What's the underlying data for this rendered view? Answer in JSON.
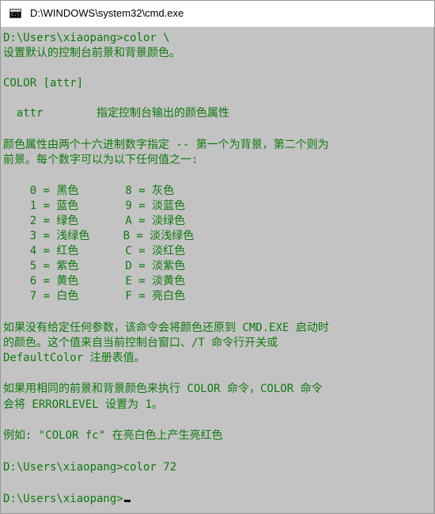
{
  "window": {
    "title": "D:\\WINDOWS\\system32\\cmd.exe",
    "icon_text": "C:\\"
  },
  "console": {
    "lines": [
      "D:\\Users\\xiaopang>color \\",
      "设置默认的控制台前景和背景颜色。",
      "",
      "COLOR [attr]",
      "",
      "  attr        指定控制台输出的颜色属性",
      "",
      "颜色属性由两个十六进制数字指定 -- 第一个为背景，第二个则为",
      "前景。每个数字可以为以下任何值之一:",
      "",
      "    0 = 黑色       8 = 灰色",
      "    1 = 蓝色       9 = 淡蓝色",
      "    2 = 绿色       A = 淡绿色",
      "    3 = 浅绿色     B = 淡浅绿色",
      "    4 = 红色       C = 淡红色",
      "    5 = 紫色       D = 淡紫色",
      "    6 = 黄色       E = 淡黄色",
      "    7 = 白色       F = 亮白色",
      "",
      "如果没有给定任何参数，该命令会将颜色还原到 CMD.EXE 启动时",
      "的颜色。这个值来自当前控制台窗口、/T 命令行开关或",
      "DefaultColor 注册表值。",
      "",
      "如果用相同的前景和背景颜色来执行 COLOR 命令，COLOR 命令",
      "会将 ERRORLEVEL 设置为 1。",
      "",
      "例如: \"COLOR fc\" 在亮白色上产生亮红色",
      "",
      "D:\\Users\\xiaopang>color 72",
      "",
      "D:\\Users\\xiaopang>"
    ]
  },
  "colors": {
    "console_background": "#c3c3c3",
    "console_text": "#0f7a0f",
    "cursor": "#000000"
  }
}
